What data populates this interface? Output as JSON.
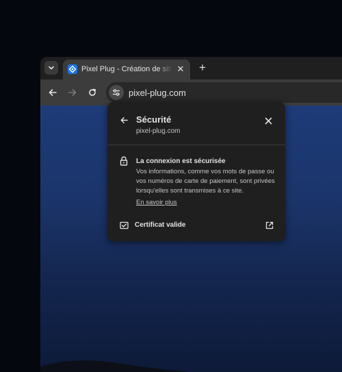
{
  "tab": {
    "title": "Pixel Plug - Création de sites web",
    "close_glyph": "✕"
  },
  "newtab": {
    "glyph": "+"
  },
  "omnibox": {
    "url": "pixel-plug.com"
  },
  "popup": {
    "title": "Sécurité",
    "domain": "pixel-plug.com",
    "connection_title": "La connexion est sécurisée",
    "connection_desc": "Vos informations, comme vos mots de passe ou vos numéros de carte de paiement, sont privées lorsqu'elles sont transmises à ce site.",
    "learn_more": "En savoir plus",
    "certificate_label": "Certificat valide"
  },
  "icons": {
    "tab_search": "chevron-down-icon",
    "favicon": "pixel-plug-favicon",
    "back": "arrow-left-icon",
    "forward": "arrow-right-icon",
    "reload": "reload-icon",
    "site_info": "tune-icon",
    "popup_back": "arrow-left-icon",
    "popup_close": "close-icon",
    "lock": "lock-icon",
    "certificate": "certificate-icon",
    "external": "open-external-icon"
  },
  "colors": {
    "favicon_accent": "#1a73e8",
    "popup_bg": "#1f1f1f",
    "page_bg": "#1e3b78"
  }
}
